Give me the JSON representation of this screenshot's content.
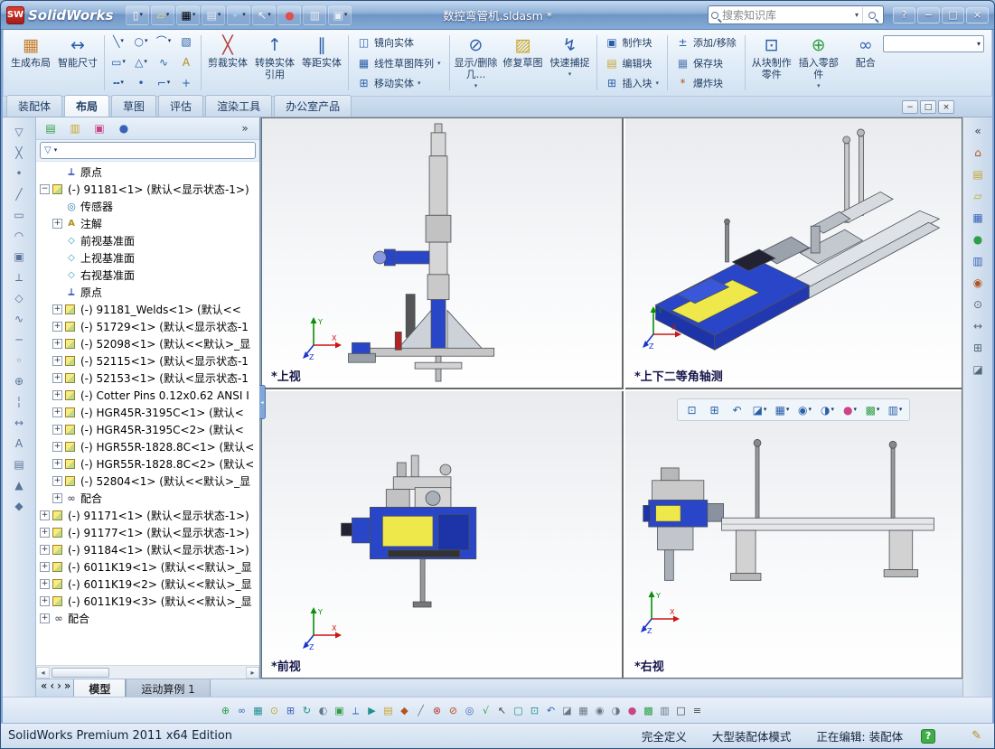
{
  "titlebar": {
    "logo_text": "SW",
    "app_name": "SolidWorks",
    "doc_title": "数控弯管机.sldasm *",
    "search_placeholder": "搜索知识库",
    "tools": [
      {
        "name": "new-document",
        "g": "▯",
        "c": "#f8fafc",
        "dd": true
      },
      {
        "name": "open-document",
        "g": "▱",
        "c": "#f3d878",
        "dd": true
      },
      {
        "name": "save-document",
        "g": "▦",
        "c": "#b7ccе?",
        "dd": true
      },
      {
        "name": "print-document",
        "g": "▤",
        "c": "#e6ecf3",
        "dd": true
      },
      {
        "name": "undo",
        "g": "↶",
        "c": "#9cd1ff",
        "dd": true
      },
      {
        "name": "select",
        "g": "↖",
        "c": "#f2f6fa",
        "dd": true
      },
      {
        "name": "rebuild",
        "g": "●",
        "c": "#e05050"
      },
      {
        "name": "file-properties",
        "g": "▥",
        "c": "#e6ecf3"
      },
      {
        "name": "options",
        "g": "▣",
        "c": "#e6ecf3",
        "dd": true
      }
    ],
    "window_buttons": [
      {
        "name": "help",
        "g": "?"
      },
      {
        "name": "minimize",
        "g": "−"
      },
      {
        "name": "maximize",
        "g": "□"
      },
      {
        "name": "close",
        "g": "×"
      }
    ]
  },
  "ribbon": {
    "create_layout": "生成布局",
    "smart_dimension": "智能尺寸",
    "trim_entities": "剪裁实体",
    "convert_entities": "转换实体引用",
    "offset_entities": "等距实体",
    "mirror_entities": "镜向实体",
    "linear_sketch_pattern": "线性草图阵列",
    "move_entities": "移动实体",
    "display_delete_relations": "显示/删除几...",
    "repair_sketch": "修复草图",
    "quick_snaps": "快速捕捉",
    "make_block": "制作块",
    "edit_block": "编辑块",
    "insert_block": "插入块",
    "add_remove": "添加/移除",
    "save_block": "保存块",
    "explode_block": "爆炸块",
    "make_part_from_block": "从块制作零件",
    "insert_components": "插入零部件",
    "mate": "配合",
    "sketch_tools": [
      {
        "name": "line",
        "g": "╲",
        "c": "#2a5fa8",
        "dd": true
      },
      {
        "name": "circle",
        "g": "○",
        "c": "#2a5fa8",
        "dd": true
      },
      {
        "name": "arc",
        "g": "⌒",
        "c": "#2a5fa8",
        "dd": true
      },
      {
        "name": "selection-box",
        "g": "▧",
        "c": "#2a5fa8"
      },
      {
        "name": "rectangle",
        "g": "▭",
        "c": "#2a5fa8",
        "dd": true
      },
      {
        "name": "polygon",
        "g": "△",
        "c": "#2a5fa8",
        "dd": true
      },
      {
        "name": "spline",
        "g": "∿",
        "c": "#2a5fa8"
      },
      {
        "name": "text",
        "g": "A",
        "c": "#b08f20"
      },
      {
        "name": "centerline",
        "g": "╍",
        "c": "#2a5fa8",
        "dd": true
      },
      {
        "name": "point",
        "g": "•",
        "c": "#2a5fa8"
      },
      {
        "name": "sketch-fillet",
        "g": "⌐",
        "c": "#2a5fa8",
        "dd": true
      },
      {
        "name": "construction-geometry",
        "g": "+",
        "c": "#2a5fa8"
      }
    ]
  },
  "command_tabs": [
    {
      "id": "assembly",
      "label": "装配体",
      "active": false
    },
    {
      "id": "layout",
      "label": "布局",
      "active": true
    },
    {
      "id": "sketch",
      "label": "草图",
      "active": false
    },
    {
      "id": "evaluate",
      "label": "评估",
      "active": false
    },
    {
      "id": "render-tools",
      "label": "渲染工具",
      "active": false
    },
    {
      "id": "office-products",
      "label": "办公室产品",
      "active": false
    }
  ],
  "child_window_controls": [
    {
      "name": "child-minimize",
      "g": "−"
    },
    {
      "name": "child-restore",
      "g": "□"
    },
    {
      "name": "child-close",
      "g": "×"
    }
  ],
  "left_strip": [
    {
      "name": "filter-toggle",
      "g": "▽",
      "c": "#5a7398"
    },
    {
      "name": "clear-filters",
      "g": "╳",
      "c": "#5a7398"
    },
    {
      "name": "filter-vertices",
      "g": "•",
      "c": "#5a7398"
    },
    {
      "name": "filter-edges",
      "g": "╱",
      "c": "#5a7398"
    },
    {
      "name": "filter-faces",
      "g": "▭",
      "c": "#5a7398"
    },
    {
      "name": "filter-surface-bodies",
      "g": "◠",
      "c": "#5a7398"
    },
    {
      "name": "filter-solid-bodies",
      "g": "▣",
      "c": "#5a7398"
    },
    {
      "name": "filter-axes",
      "g": "⟂",
      "c": "#5a7398"
    },
    {
      "name": "filter-planes",
      "g": "◇",
      "c": "#5a7398"
    },
    {
      "name": "filter-sketches",
      "g": "∿",
      "c": "#5a7398"
    },
    {
      "name": "filter-sketch-segments",
      "g": "─",
      "c": "#5a7398"
    },
    {
      "name": "filter-midpoints",
      "g": "◦",
      "c": "#5a7398"
    },
    {
      "name": "filter-center-marks",
      "g": "⊕",
      "c": "#5a7398"
    },
    {
      "name": "filter-centerlines",
      "g": "╎",
      "c": "#5a7398"
    },
    {
      "name": "filter-dimensions",
      "g": "↔",
      "c": "#5a7398"
    },
    {
      "name": "filter-annotations",
      "g": "A",
      "c": "#5a7398"
    },
    {
      "name": "filter-notes",
      "g": "▤",
      "c": "#5a7398"
    },
    {
      "name": "filter-welds",
      "g": "▲",
      "c": "#5a7398"
    },
    {
      "name": "filter-datums",
      "g": "◆",
      "c": "#5a7398"
    }
  ],
  "panel": {
    "tabs": [
      {
        "name": "featuremanager-tab",
        "g": "▤",
        "c": "#2f9e44"
      },
      {
        "name": "propertymanager-tab",
        "g": "▥",
        "c": "#caa52a"
      },
      {
        "name": "configurationmanager-tab",
        "g": "▣",
        "c": "#cc4488"
      },
      {
        "name": "displaymanager-tab",
        "g": "●",
        "c": "#3a62b8"
      },
      {
        "name": "panel-tabs-overflow",
        "g": "»",
        "c": "#334455"
      }
    ]
  },
  "tree": {
    "items": [
      {
        "lvl": 1,
        "icon": "origin",
        "label": "原点",
        "exp": ""
      },
      {
        "lvl": 0,
        "icon": "component",
        "label": "(-) 91181<1> (默认<显示状态-1>)",
        "exp": "-"
      },
      {
        "lvl": 1,
        "icon": "sensors",
        "label": "传感器",
        "exp": ""
      },
      {
        "lvl": 1,
        "icon": "annotations",
        "label": "注解",
        "exp": "+"
      },
      {
        "lvl": 1,
        "icon": "plane",
        "label": "前视基准面",
        "exp": ""
      },
      {
        "lvl": 1,
        "icon": "plane",
        "label": "上视基准面",
        "exp": ""
      },
      {
        "lvl": 1,
        "icon": "plane",
        "label": "右视基准面",
        "exp": ""
      },
      {
        "lvl": 1,
        "icon": "origin",
        "label": "原点",
        "exp": ""
      },
      {
        "lvl": 1,
        "icon": "component",
        "label": "(-) 91181_Welds<1> (默认<<",
        "exp": "+"
      },
      {
        "lvl": 1,
        "icon": "component",
        "label": "(-) 51729<1> (默认<显示状态-1",
        "exp": "+"
      },
      {
        "lvl": 1,
        "icon": "component",
        "label": "(-) 52098<1> (默认<<默认>_显",
        "exp": "+"
      },
      {
        "lvl": 1,
        "icon": "component",
        "label": "(-) 52115<1> (默认<显示状态-1",
        "exp": "+"
      },
      {
        "lvl": 1,
        "icon": "component",
        "label": "(-) 52153<1> (默认<显示状态-1",
        "exp": "+"
      },
      {
        "lvl": 1,
        "icon": "component",
        "label": "(-) Cotter Pins 0.12x0.62 ANSI I",
        "exp": "+"
      },
      {
        "lvl": 1,
        "icon": "component",
        "label": "(-) HGR45R-3195C<1> (默认<",
        "exp": "+"
      },
      {
        "lvl": 1,
        "icon": "component",
        "label": "(-) HGR45R-3195C<2> (默认<",
        "exp": "+"
      },
      {
        "lvl": 1,
        "icon": "component",
        "label": "(-) HGR55R-1828.8C<1> (默认<",
        "exp": "+"
      },
      {
        "lvl": 1,
        "icon": "component",
        "label": "(-) HGR55R-1828.8C<2> (默认<",
        "exp": "+"
      },
      {
        "lvl": 1,
        "icon": "component",
        "label": "(-) 52804<1> (默认<<默认>_显",
        "exp": "+"
      },
      {
        "lvl": 1,
        "icon": "mates",
        "label": "配合",
        "exp": "+"
      },
      {
        "lvl": 0,
        "icon": "component",
        "label": "(-) 91171<1> (默认<显示状态-1>)",
        "exp": "+"
      },
      {
        "lvl": 0,
        "icon": "component",
        "label": "(-) 91177<1> (默认<显示状态-1>)",
        "exp": "+"
      },
      {
        "lvl": 0,
        "icon": "component",
        "label": "(-) 91184<1> (默认<显示状态-1>)",
        "exp": "+"
      },
      {
        "lvl": 0,
        "icon": "component",
        "label": "(-) 6011K19<1> (默认<<默认>_显",
        "exp": "+"
      },
      {
        "lvl": 0,
        "icon": "component",
        "label": "(-) 6011K19<2> (默认<<默认>_显",
        "exp": "+"
      },
      {
        "lvl": 0,
        "icon": "component",
        "label": "(-) 6011K19<3> (默认<<默认>_显",
        "exp": "+"
      },
      {
        "lvl": 0,
        "icon": "mates",
        "label": "配合",
        "exp": "+"
      }
    ]
  },
  "model_bar": {
    "nav": [
      {
        "name": "scroll-first",
        "g": "«"
      },
      {
        "name": "scroll-prev",
        "g": "‹"
      },
      {
        "name": "scroll-next",
        "g": "›"
      },
      {
        "name": "scroll-last",
        "g": "»"
      }
    ],
    "tabs": [
      {
        "id": "model",
        "label": "模型",
        "active": true
      },
      {
        "id": "motion-study-1",
        "label": "运动算例 1",
        "active": false
      }
    ]
  },
  "viewports": {
    "top_left_label": "*上视",
    "top_right_label": "*上下二等角轴测",
    "bottom_left_label": "*前视",
    "bottom_right_label": "*右视",
    "headsup": [
      {
        "name": "zoom-to-fit",
        "g": "⊡",
        "c": "#2a5fa8"
      },
      {
        "name": "zoom-to-area",
        "g": "⊞",
        "c": "#2a5fa8"
      },
      {
        "name": "previous-view",
        "g": "↶",
        "c": "#2a5fa8"
      },
      {
        "name": "section-view",
        "g": "◪",
        "c": "#2a5fa8",
        "dd": true
      },
      {
        "name": "view-orientation",
        "g": "▦",
        "c": "#2a5fa8",
        "dd": true
      },
      {
        "name": "display-style",
        "g": "◉",
        "c": "#2a5fa8",
        "dd": true
      },
      {
        "name": "hide-show-items",
        "g": "◑",
        "c": "#2a5fa8",
        "dd": true
      },
      {
        "name": "edit-appearance",
        "g": "●",
        "c": "#cc4488",
        "dd": true
      },
      {
        "name": "apply-scene",
        "g": "▩",
        "c": "#2f9e44",
        "dd": true
      },
      {
        "name": "view-settings",
        "g": "▥",
        "c": "#2a5fa8",
        "dd": true
      }
    ]
  },
  "right_strip": [
    {
      "name": "collapse-task-pane",
      "g": "«",
      "c": "#334455"
    },
    {
      "name": "solidworks-resources",
      "g": "⌂",
      "c": "#b3541e"
    },
    {
      "name": "design-library",
      "g": "▤",
      "c": "#caa52a"
    },
    {
      "name": "file-explorer",
      "g": "▱",
      "c": "#caa52a"
    },
    {
      "name": "view-palette",
      "g": "▦",
      "c": "#3a62b8"
    },
    {
      "name": "appearances-scenes",
      "g": "●",
      "c": "#2f9e44"
    },
    {
      "name": "custom-properties",
      "g": "▥",
      "c": "#3a62b8"
    },
    {
      "name": "document-recovery",
      "g": "◉",
      "c": "#b3541e"
    },
    {
      "name": "auto-hide-pin",
      "g": "⊙",
      "c": "#556677"
    },
    {
      "name": "measure-tool",
      "g": "↔",
      "c": "#556677"
    },
    {
      "name": "mass-properties",
      "g": "⊞",
      "c": "#556677"
    },
    {
      "name": "section-properties",
      "g": "◪",
      "c": "#556677"
    }
  ],
  "bottom_toolbar": [
    {
      "name": "insert-component",
      "g": "⊕",
      "c": "#2f9e44"
    },
    {
      "name": "mate",
      "g": "∞",
      "c": "#3a62b8"
    },
    {
      "name": "linear-component-pattern",
      "g": "▦",
      "c": "#1f8f8f"
    },
    {
      "name": "smart-fasteners",
      "g": "⊙",
      "c": "#caa52a"
    },
    {
      "name": "move-component",
      "g": "⊞",
      "c": "#3a62b8"
    },
    {
      "name": "rotate-component",
      "g": "↻",
      "c": "#1f8f8f"
    },
    {
      "name": "show-hidden-components",
      "g": "◐",
      "c": "#667788"
    },
    {
      "name": "assembly-features",
      "g": "▣",
      "c": "#2f9e44"
    },
    {
      "name": "reference-geometry",
      "g": "⟂",
      "c": "#3a62b8"
    },
    {
      "name": "new-motion-study",
      "g": "▶",
      "c": "#1f8f8f"
    },
    {
      "name": "bill-of-materials",
      "g": "▤",
      "c": "#caa52a"
    },
    {
      "name": "exploded-view",
      "g": "◆",
      "c": "#b3541e"
    },
    {
      "name": "explode-line-sketch",
      "g": "╱",
      "c": "#667788"
    },
    {
      "name": "interference-detection",
      "g": "⊗",
      "c": "#b33b3b"
    },
    {
      "name": "clearance-verification",
      "g": "⊘",
      "c": "#b3541e"
    },
    {
      "name": "hole-alignment",
      "g": "◎",
      "c": "#3a62b8"
    },
    {
      "name": "assembly-xpert",
      "g": "√",
      "c": "#2f9e44"
    },
    {
      "name": "select-arrow",
      "g": "↖",
      "c": "#444444"
    },
    {
      "name": "zoom-to-fit-tool",
      "g": "▢",
      "c": "#1f8f8f"
    },
    {
      "name": "zoom-to-area-tool",
      "g": "⊡",
      "c": "#1f8f8f"
    },
    {
      "name": "previous-view-tool",
      "g": "↶",
      "c": "#3a62b8"
    },
    {
      "name": "section-view-tool",
      "g": "◪",
      "c": "#667788"
    },
    {
      "name": "view-orientation-tool",
      "g": "▦",
      "c": "#667788"
    },
    {
      "name": "display-style-tool",
      "g": "◉",
      "c": "#667788"
    },
    {
      "name": "hide-show-items-tool",
      "g": "◑",
      "c": "#667788"
    },
    {
      "name": "edit-appearance-tool",
      "g": "●",
      "c": "#cc4488"
    },
    {
      "name": "apply-scene-tool",
      "g": "▩",
      "c": "#2f9e44"
    },
    {
      "name": "view-settings-tool",
      "g": "▥",
      "c": "#667788"
    },
    {
      "name": "full-screen",
      "g": "□",
      "c": "#444444"
    },
    {
      "name": "toolbar-options",
      "g": "≡",
      "c": "#444444"
    }
  ],
  "statusbar": {
    "left": "SolidWorks Premium 2011 x64 Edition",
    "right_items": [
      "完全定义",
      "大型装配体模式",
      "正在编辑: 装配体"
    ]
  }
}
